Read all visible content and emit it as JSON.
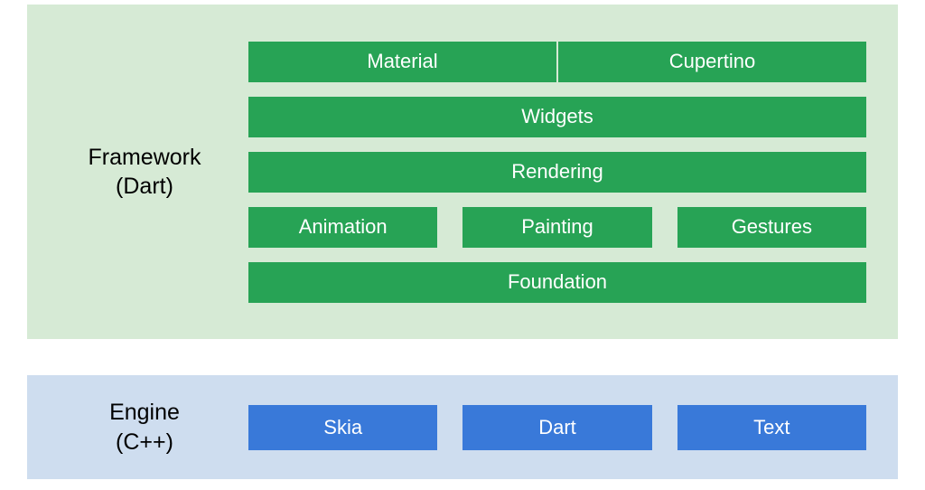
{
  "framework": {
    "label_line1": "Framework",
    "label_line2": "(Dart)",
    "rows": {
      "top": {
        "material": "Material",
        "cupertino": "Cupertino"
      },
      "widgets": "Widgets",
      "rendering": "Rendering",
      "mid": {
        "animation": "Animation",
        "painting": "Painting",
        "gestures": "Gestures"
      },
      "foundation": "Foundation"
    }
  },
  "engine": {
    "label_line1": "Engine",
    "label_line2": "(C++)",
    "items": {
      "skia": "Skia",
      "dart": "Dart",
      "text": "Text"
    }
  },
  "colors": {
    "framework_bg": "#d6ead5",
    "engine_bg": "#ceddef",
    "framework_block": "#27a355",
    "engine_block": "#3979d9"
  }
}
